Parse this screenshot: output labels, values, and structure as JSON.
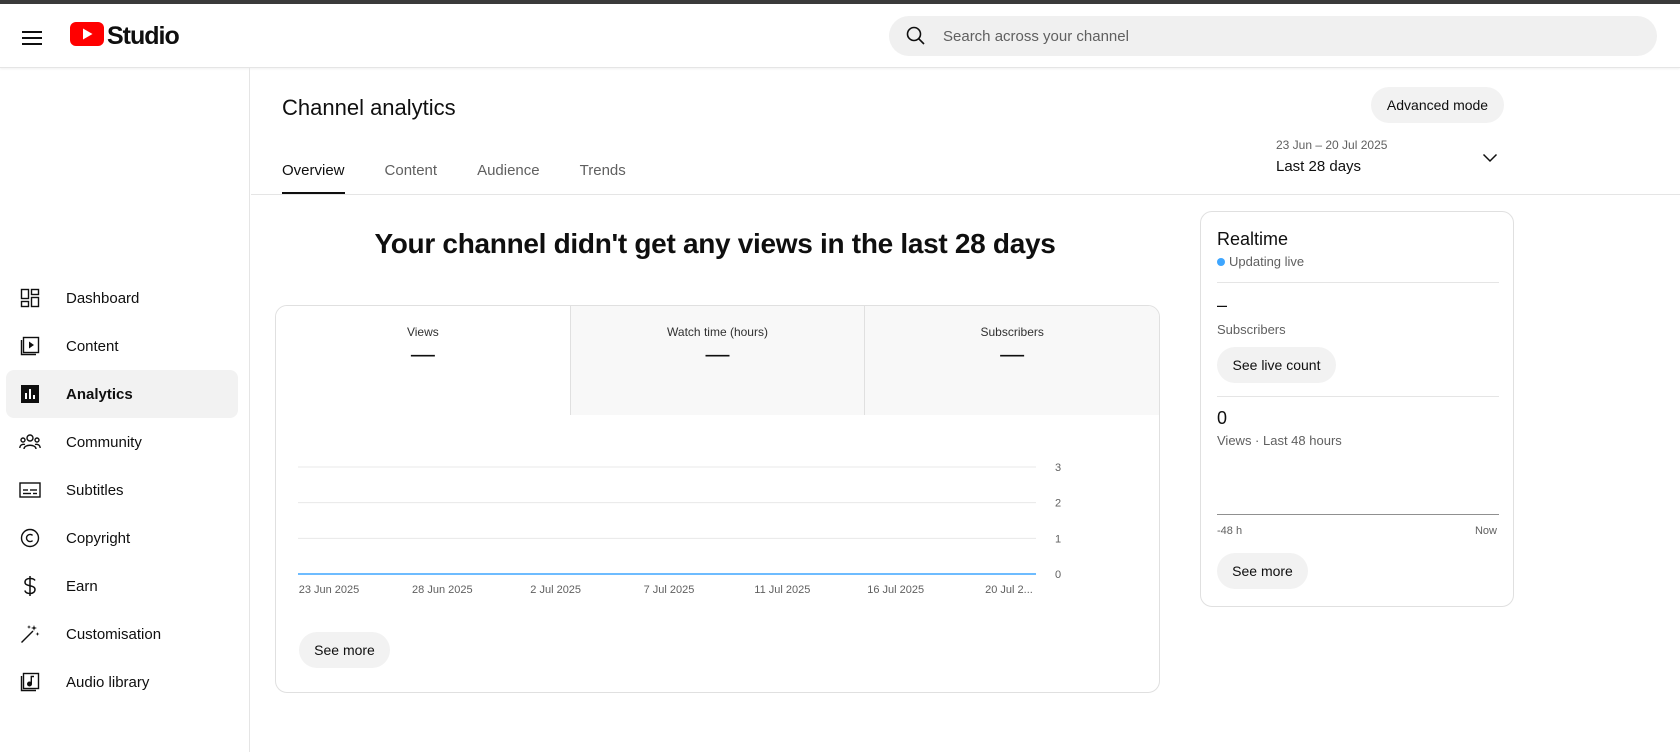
{
  "header": {
    "app_name": "Studio",
    "search_placeholder": "Search across your channel",
    "menu_icon": "hamburger-menu-icon",
    "logo_icon": "youtube-logo-icon",
    "brand_color": "#ff0000"
  },
  "sidebar": {
    "items": [
      {
        "label": "Dashboard",
        "icon": "dashboard-icon",
        "active": false
      },
      {
        "label": "Content",
        "icon": "content-icon",
        "active": false
      },
      {
        "label": "Analytics",
        "icon": "analytics-icon",
        "active": true
      },
      {
        "label": "Community",
        "icon": "community-icon",
        "active": false
      },
      {
        "label": "Subtitles",
        "icon": "subtitles-icon",
        "active": false
      },
      {
        "label": "Copyright",
        "icon": "copyright-icon",
        "active": false
      },
      {
        "label": "Earn",
        "icon": "earn-icon",
        "active": false
      },
      {
        "label": "Customisation",
        "icon": "customisation-icon",
        "active": false
      },
      {
        "label": "Audio library",
        "icon": "audio-library-icon",
        "active": false
      }
    ]
  },
  "page": {
    "title": "Channel analytics",
    "advanced_mode_label": "Advanced mode",
    "tabs": [
      {
        "label": "Overview",
        "active": true
      },
      {
        "label": "Content",
        "active": false
      },
      {
        "label": "Audience",
        "active": false
      },
      {
        "label": "Trends",
        "active": false
      }
    ],
    "date_range": {
      "dates": "23 Jun – 20 Jul 2025",
      "label": "Last 28 days"
    },
    "headline": "Your channel didn't get any views in the last 28 days"
  },
  "metrics": [
    {
      "label": "Views",
      "value": "—",
      "active": true
    },
    {
      "label": "Watch time (hours)",
      "value": "—",
      "active": false
    },
    {
      "label": "Subscribers",
      "value": "—",
      "active": false
    }
  ],
  "chart_data": {
    "type": "line",
    "x": [
      "23 Jun 2025",
      "28 Jun 2025",
      "2 Jul 2025",
      "7 Jul 2025",
      "11 Jul 2025",
      "16 Jul 2025",
      "20 Jul 2..."
    ],
    "series": [
      {
        "values": [
          0,
          0,
          0,
          0,
          0,
          0,
          0
        ]
      }
    ],
    "ylim": [
      0,
      3
    ],
    "yticks": [
      "0",
      "1",
      "2",
      "3"
    ],
    "line_color": "#3ea6ff",
    "grid": true
  },
  "card": {
    "see_more_label": "See more"
  },
  "realtime": {
    "title": "Realtime",
    "status": "Updating live",
    "subscribers_value": "–",
    "subscribers_label": "Subscribers",
    "see_live_count_label": "See live count",
    "views_value": "0",
    "views_label": "Views · Last 48 hours",
    "axis_left": "-48 h",
    "axis_right": "Now",
    "see_more_label": "See more",
    "live_dot_color": "#3ea6ff"
  }
}
